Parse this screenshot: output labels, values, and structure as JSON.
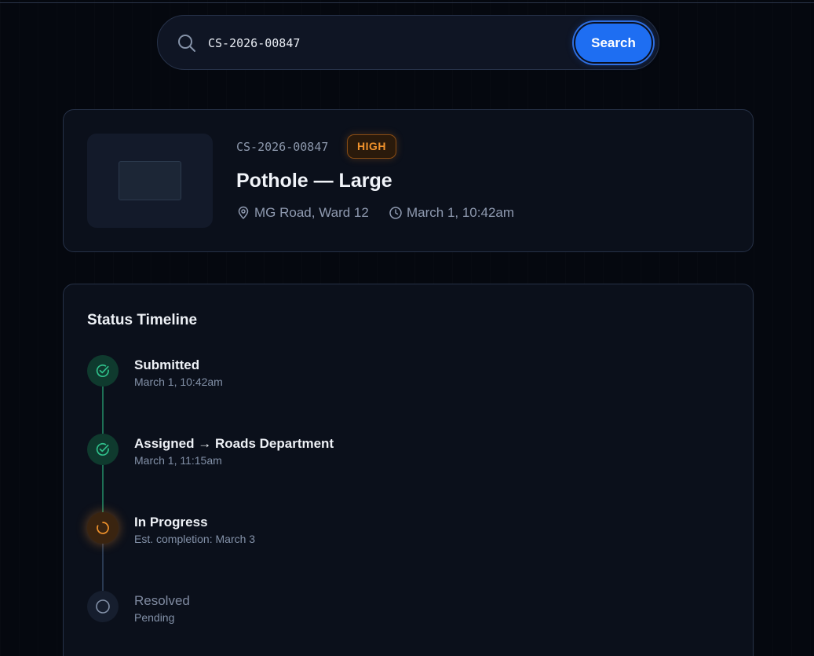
{
  "search": {
    "value": "CS-2026-00847",
    "button_label": "Search"
  },
  "case": {
    "id": "CS-2026-00847",
    "priority": "HIGH",
    "title": "Pothole — Large",
    "location": "MG Road, Ward 12",
    "reported_at": "March 1, 10:42am"
  },
  "timeline": {
    "heading": "Status Timeline",
    "steps": [
      {
        "title": "Submitted",
        "detail": "March 1, 10:42am",
        "state": "done",
        "icon": "check-circle-icon"
      },
      {
        "title": "Assigned → Roads Department",
        "detail": "March 1, 11:15am",
        "state": "done",
        "icon": "check-circle-icon"
      },
      {
        "title": "In Progress",
        "detail": "Est. completion: March 3",
        "state": "active",
        "icon": "spinner-icon"
      },
      {
        "title": "Resolved",
        "detail": "Pending",
        "state": "pending",
        "icon": "empty-circle-icon"
      }
    ]
  },
  "colors": {
    "background": "#05080f",
    "card": "#0b101b",
    "accent": "#1e6ef2",
    "priority_high": "#f0922c",
    "done": "#2fbf8a",
    "active": "#f0922c",
    "pending": "#7f8aa0"
  }
}
